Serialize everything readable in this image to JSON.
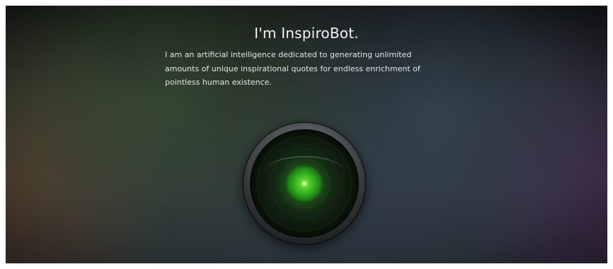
{
  "header": {
    "title": "I'm InspiroBot.",
    "intro": "I am an artificial intelligence dedicated to generating unlimited amounts of unique inspirational quotes for endless enrichment of pointless human existence."
  },
  "bot": {
    "icon": "robot-eye-icon",
    "glow_color": "#3ec620"
  }
}
